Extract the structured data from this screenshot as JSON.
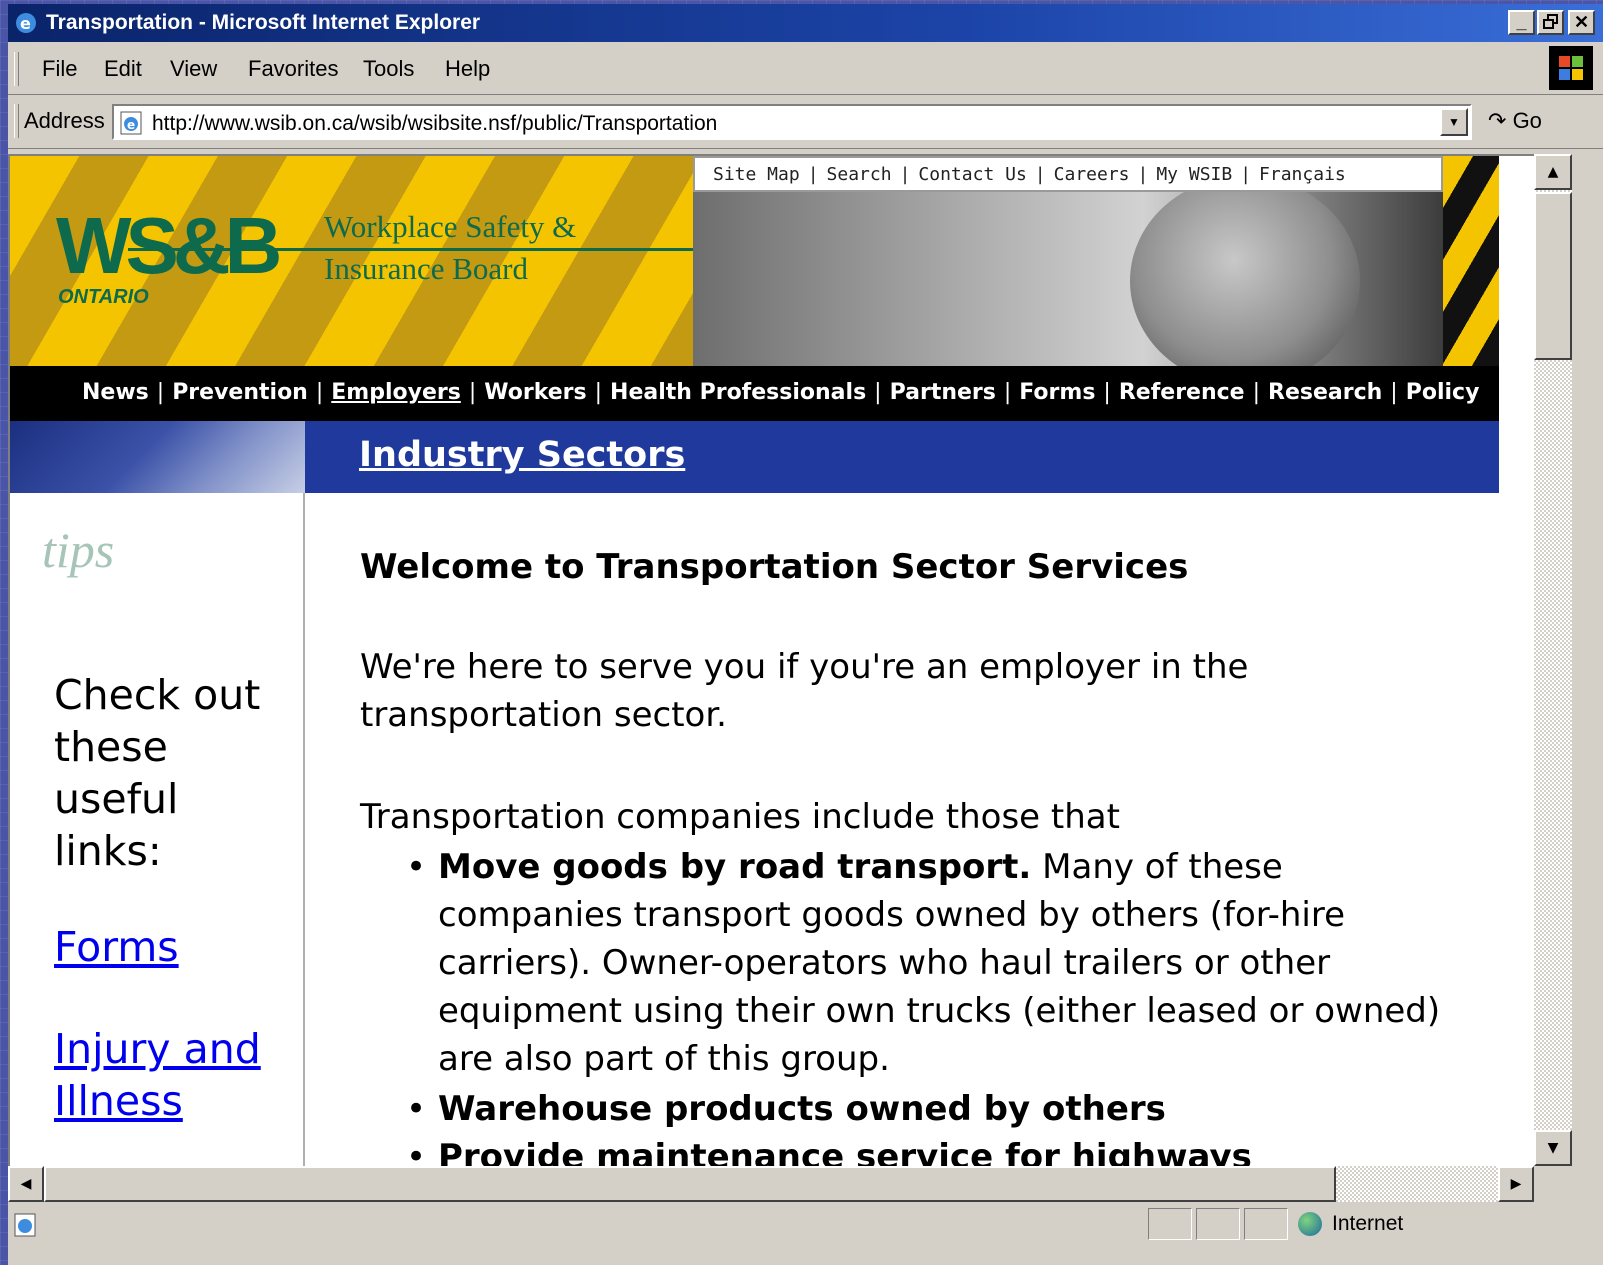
{
  "window": {
    "title": "Transportation - Microsoft Internet Explorer",
    "min": "_",
    "max": "🗗",
    "close": "✕"
  },
  "menu": {
    "file": "File",
    "edit": "Edit",
    "view": "View",
    "favorites": "Favorites",
    "tools": "Tools",
    "help": "Help"
  },
  "address": {
    "label": "Address",
    "url": "http://www.wsib.on.ca/wsib/wsibsite.nsf/public/Transportation",
    "go": "Go"
  },
  "header": {
    "logo": "WS&B",
    "logo_region": "ONTARIO",
    "org_line1": "Workplace Safety &",
    "org_line2": "Insurance Board",
    "utility_links": [
      "Site Map",
      "Search",
      "Contact Us",
      "Careers",
      "My WSIB",
      "Français"
    ]
  },
  "nav": [
    "News",
    "Prevention",
    "Employers",
    "Workers",
    "Health Professionals",
    "Partners",
    "Forms",
    "Reference",
    "Research",
    "Policy"
  ],
  "section": {
    "title": "Industry Sectors"
  },
  "sidebar": {
    "heading": "tips",
    "intro": "Check out these useful links:",
    "links": [
      "Forms",
      "Injury and Illness"
    ]
  },
  "content": {
    "heading": "Welcome to Transportation Sector Services",
    "para1": "We're here to serve you if you're an employer in the transportation sector.",
    "para2": "Transportation companies include those that",
    "bullets": [
      {
        "bold": "Move goods by road transport.",
        "rest": " Many of these companies transport goods owned by others (for-hire carriers). Owner-operators who haul trailers or other equipment using their own trucks (either leased or owned) are also part of this group."
      },
      {
        "bold": "Warehouse products owned by others",
        "rest": ""
      },
      {
        "bold": "Provide maintenance service for highways",
        "rest": ""
      }
    ]
  },
  "status": {
    "zone": "Internet"
  },
  "colors": {
    "titlebar": "#0a246a",
    "chrome": "#d4d0c8",
    "wsib_yellow": "#f5c400",
    "wsib_green": "#0e6a4c",
    "section_blue": "#1f3a9c",
    "link": "#0000ee"
  }
}
